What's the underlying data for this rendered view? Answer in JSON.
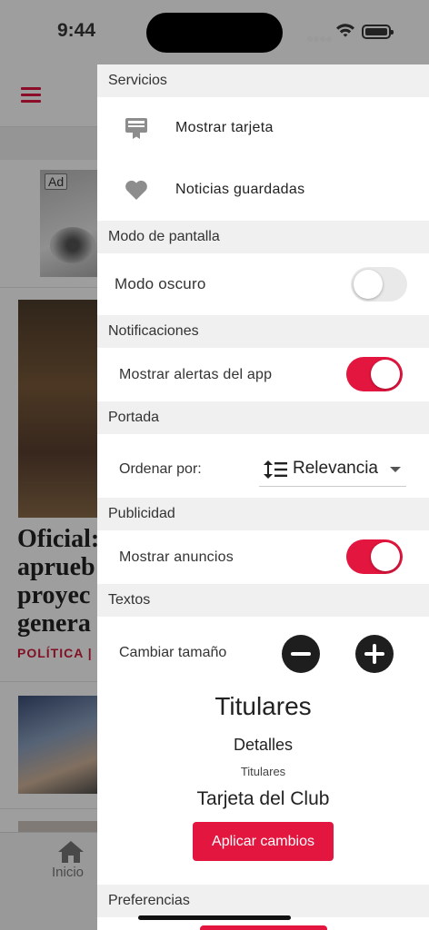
{
  "status": {
    "time": "9:44"
  },
  "background": {
    "ad_label": "Ad",
    "headline_lines": [
      "Oficial:",
      "aprueb",
      "proyec",
      "genera"
    ],
    "category": "POLÍTICA  |",
    "tab_home": "Inicio"
  },
  "drawer": {
    "services": {
      "header": "Servicios",
      "items": [
        {
          "icon": "card-icon",
          "label": "Mostrar tarjeta"
        },
        {
          "icon": "heart-icon",
          "label": "Noticias guardadas"
        }
      ]
    },
    "screen_mode": {
      "header": "Modo de pantalla",
      "dark_mode_label": "Modo oscuro",
      "dark_mode_on": false
    },
    "notifications": {
      "header": "Notificaciones",
      "alerts_label": "Mostrar alertas del app",
      "alerts_on": true
    },
    "cover": {
      "header": "Portada",
      "sort_label": "Ordenar por:",
      "sort_value": "Relevancia"
    },
    "advertising": {
      "header": "Publicidad",
      "ads_label": "Mostrar anuncios",
      "ads_on": true
    },
    "texts": {
      "header": "Textos",
      "size_label": "Cambiar tamaño",
      "preview_headline": "Titulares",
      "preview_details": "Detalles",
      "preview_small": "Titulares",
      "preview_club": "Tarjeta del Club",
      "apply_label": "Aplicar cambios"
    },
    "preferences": {
      "header": "Preferencias"
    }
  },
  "colors": {
    "accent": "#e3163f",
    "section_bg": "#f0f0f0",
    "toggle_off": "#e9e9ea"
  }
}
